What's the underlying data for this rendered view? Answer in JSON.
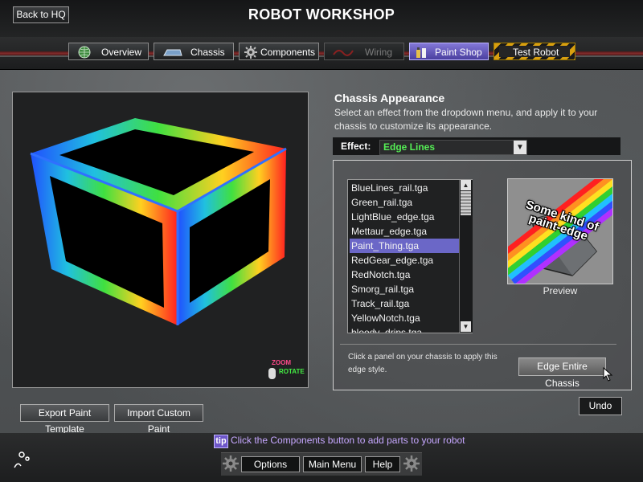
{
  "header": {
    "back_label": "Back to HQ",
    "title": "ROBOT WORKSHOP"
  },
  "tabs": [
    {
      "label": "Overview",
      "icon": "globe-icon",
      "state": "normal"
    },
    {
      "label": "Chassis",
      "icon": "chassis-icon",
      "state": "normal"
    },
    {
      "label": "Components",
      "icon": "gear-icon",
      "state": "normal"
    },
    {
      "label": "Wiring",
      "icon": "wire-icon",
      "state": "disabled"
    },
    {
      "label": "Paint Shop",
      "icon": "paint-icon",
      "state": "active"
    },
    {
      "label": "Test Robot",
      "icon": "",
      "state": "normal"
    }
  ],
  "viewport": {
    "zoom_label": "ZOOM",
    "rotate_label": "ROTATE"
  },
  "appearance": {
    "title": "Chassis Appearance",
    "description": "Select an effect from the dropdown menu, and apply it to your chassis to customize its appearance.",
    "effect_label": "Effect:",
    "effect_value": "Edge Lines"
  },
  "files": [
    "BlueLines_rail.tga",
    "Green_rail.tga",
    "LightBlue_edge.tga",
    "Mettaur_edge.tga",
    "Paint_Thing.tga",
    "RedGear_edge.tga",
    "RedNotch.tga",
    "Smorg_rail.tga",
    "Track_rail.tga",
    "YellowNotch.tga",
    "bloody_drips.tga"
  ],
  "selected_file": "Paint_Thing.tga",
  "preview": {
    "label": "Preview",
    "image_text": "Some kind of paint-edge"
  },
  "hint": "Click a panel on your chassis to apply this edge style.",
  "buttons": {
    "edge_entire": "Edge Entire Chassis",
    "undo": "Undo",
    "export": "Export Paint Template",
    "import": "Import Custom Paint"
  },
  "tip": {
    "badge": "tip",
    "text": "Click the Components button to add parts to your robot"
  },
  "menu": {
    "options": "Options",
    "main_menu": "Main Menu",
    "help": "Help"
  },
  "colors": {
    "accent": "#6b67c7",
    "effect_text": "#55ee55",
    "tip_text": "#c6a7ff"
  }
}
